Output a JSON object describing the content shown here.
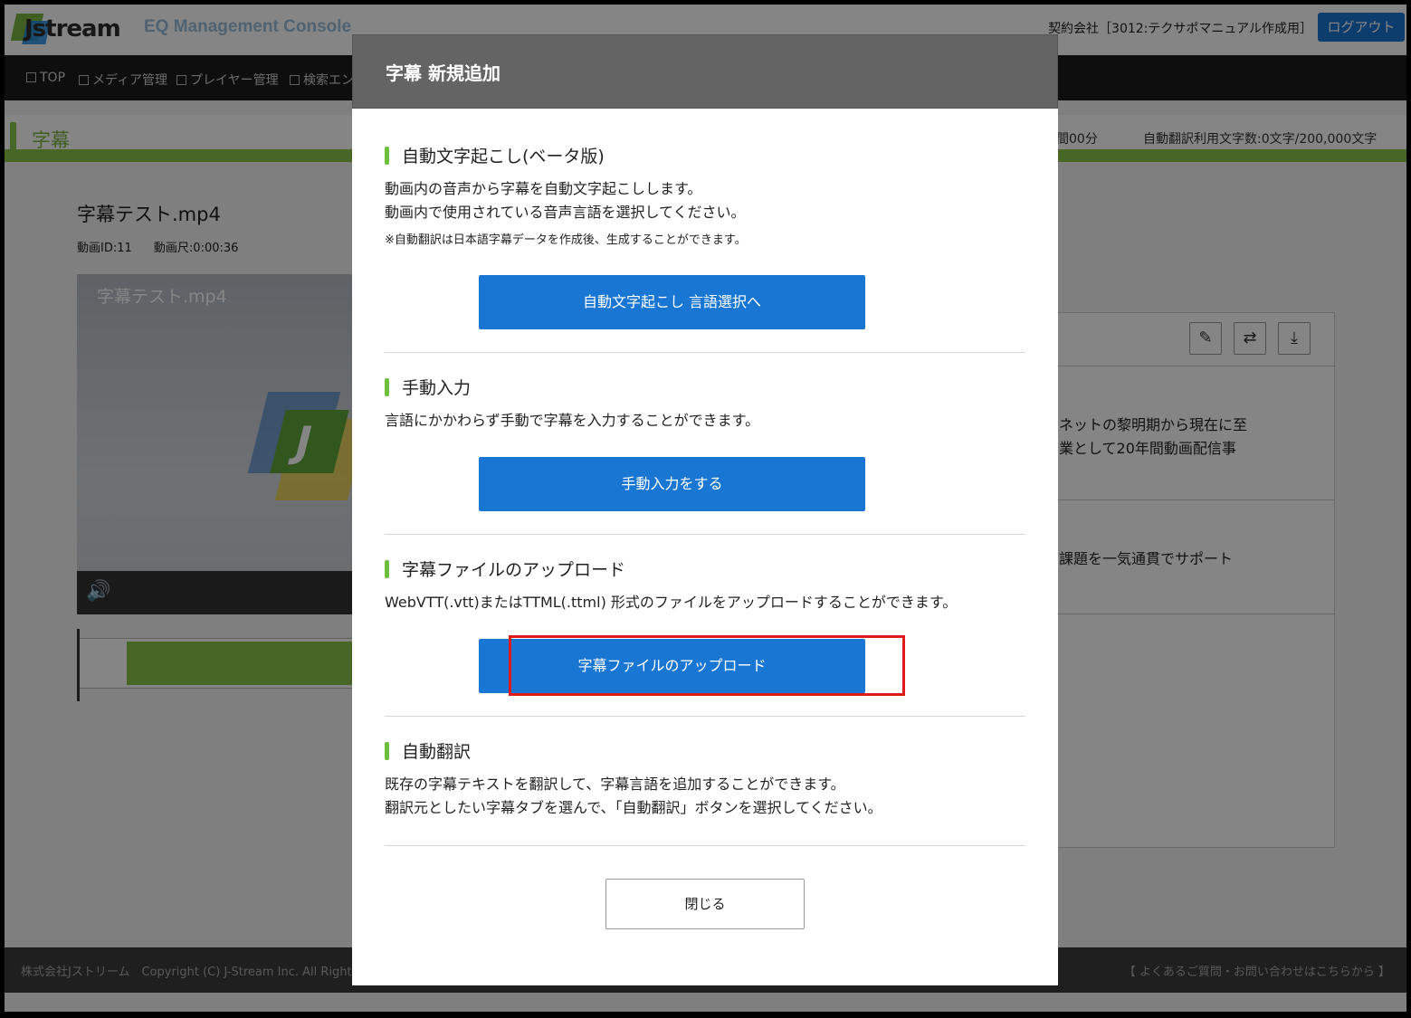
{
  "header": {
    "logo_text": "Jstream",
    "console_title": "EQ Management Console",
    "contract": "契約会社［3012:テクサポマニュアル作成用］",
    "logout_label": "ログアウト"
  },
  "nav": {
    "items": [
      "TOP",
      "メディア管理",
      "プレイヤー管理",
      "検索エン"
    ]
  },
  "subheader": {
    "title": "字幕",
    "time_fragment": "間00分",
    "translation_count": "自動翻訳利用文字数:0文字/200,000文字"
  },
  "media": {
    "title": "字幕テスト.mp4",
    "id": "動画ID:11",
    "duration": "動画尺:0:00:36",
    "player_title": "字幕テスト.mp4",
    "logo_fragment": "J"
  },
  "subtitle_panel": {
    "tools": [
      "edit-icon",
      "translate-icon",
      "download-icon"
    ],
    "row1": [
      "ネットの黎明期から現在に至",
      "業として20年間動画配信事"
    ],
    "row2": [
      "課題を一気通貫でサポート"
    ]
  },
  "footer": {
    "left": "株式会社Jストリーム　Copyright (C) J-Stream Inc. All Right",
    "right": "【 よくあるご質問・お問い合わせはこちらから 】"
  },
  "modal": {
    "title": "字幕 新規追加",
    "auto_transcribe": {
      "title": "自動文字起こし(ベータ版)",
      "desc1": "動画内の音声から字幕を自動文字起こしします。",
      "desc2": "動画内で使用されている音声言語を選択してください。",
      "note": "※自動翻訳は日本語字幕データを作成後、生成することができます。",
      "button": "自動文字起こし 言語選択へ"
    },
    "manual": {
      "title": "手動入力",
      "desc": "言語にかかわらず手動で字幕を入力することができます。",
      "button": "手動入力をする"
    },
    "upload": {
      "title": "字幕ファイルのアップロード",
      "desc": "WebVTT(.vtt)またはTTML(.ttml) 形式のファイルをアップロードすることができます。",
      "button": "字幕ファイルのアップロード"
    },
    "auto_translate": {
      "title": "自動翻訳",
      "desc1": "既存の字幕テキストを翻訳して、字幕言語を追加することができます。",
      "desc2": "翻訳元としたい字幕タブを選んで、「自動翻訳」ボタンを選択してください。"
    },
    "close_label": "閉じる"
  },
  "colors": {
    "accent_blue": "#1976d2",
    "accent_green": "#6fbf3f",
    "highlight_red": "#e01a1a"
  }
}
